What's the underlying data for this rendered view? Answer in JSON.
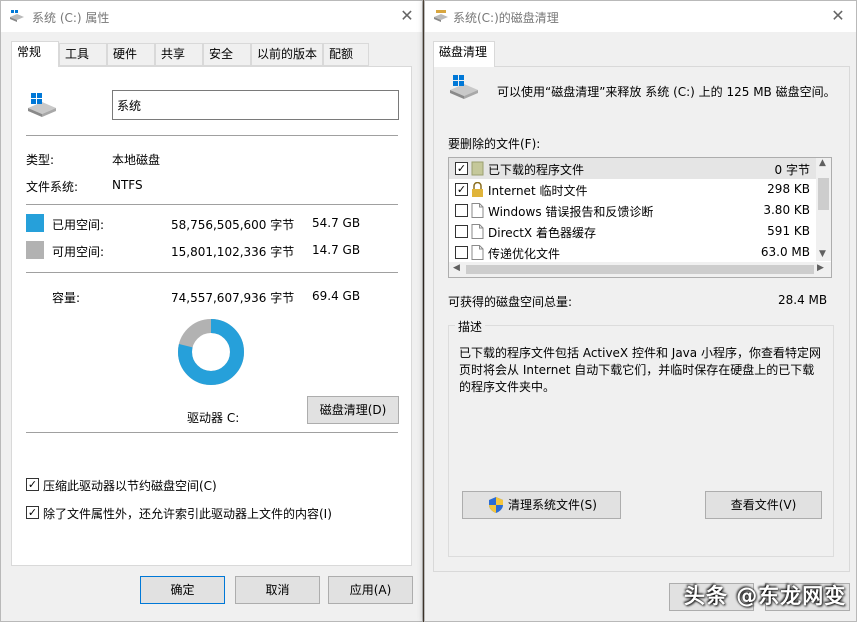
{
  "left_window": {
    "title": "系统 (C:) 属性",
    "tabs": [
      "常规",
      "工具",
      "硬件",
      "共享",
      "安全",
      "以前的版本",
      "配额"
    ],
    "volume_label_value": "系统",
    "type_label": "类型:",
    "type_value": "本地磁盘",
    "fs_label": "文件系统:",
    "fs_value": "NTFS",
    "used_label": "已用空间:",
    "used_bytes": "58,756,505,600 字节",
    "used_gb": "54.7 GB",
    "free_label": "可用空间:",
    "free_bytes": "15,801,102,336 字节",
    "free_gb": "14.7 GB",
    "capacity_label": "容量:",
    "capacity_bytes": "74,557,607,936 字节",
    "capacity_gb": "69.4 GB",
    "used_fraction": 0.788,
    "used_color": "#26a0da",
    "free_color": "#b2b2b2",
    "drive_label": "驱动器 C:",
    "cleanup_button": "磁盘清理(D)",
    "compress_checkbox": "压缩此驱动器以节约磁盘空间(C)",
    "compress_checked": true,
    "index_checkbox": "除了文件属性外，还允许索引此驱动器上文件的内容(I)",
    "index_checked": true,
    "ok_button": "确定",
    "cancel_button": "取消",
    "apply_button": "应用(A)"
  },
  "right_window": {
    "title": "系统(C:)的磁盘清理",
    "tab": "磁盘清理",
    "intro": "可以使用“磁盘清理”来释放 系统 (C:) 上的 125 MB 磁盘空间。",
    "files_label": "要删除的文件(F):",
    "files": [
      {
        "name": "已下载的程序文件",
        "size": "0 字节",
        "checked": true,
        "icon": "folder-icon",
        "selected": true
      },
      {
        "name": "Internet 临时文件",
        "size": "298 KB",
        "checked": true,
        "icon": "lock-icon",
        "selected": false
      },
      {
        "name": "Windows 错误报告和反馈诊断",
        "size": "3.80 KB",
        "checked": false,
        "icon": "file-icon",
        "selected": false
      },
      {
        "name": "DirectX 着色器缓存",
        "size": "591 KB",
        "checked": false,
        "icon": "file-icon",
        "selected": false
      },
      {
        "name": "传递优化文件",
        "size": "63.0 MB",
        "checked": false,
        "icon": "file-icon",
        "selected": false
      }
    ],
    "total_label": "可获得的磁盘空间总量:",
    "total_value": "28.4 MB",
    "desc_label": "描述",
    "desc_lines": [
      "已下载的程序文件包括 ActiveX 控件和 Java 小程序，你查看特定网",
      "页时将会从 Internet 自动下载它们，并临时保存在硬盘上的已下载",
      "的程序文件夹中。"
    ],
    "cleanup_system_button": "清理系统文件(S)",
    "view_files_button": "查看文件(V)"
  },
  "watermark": "头条 @东龙网变"
}
